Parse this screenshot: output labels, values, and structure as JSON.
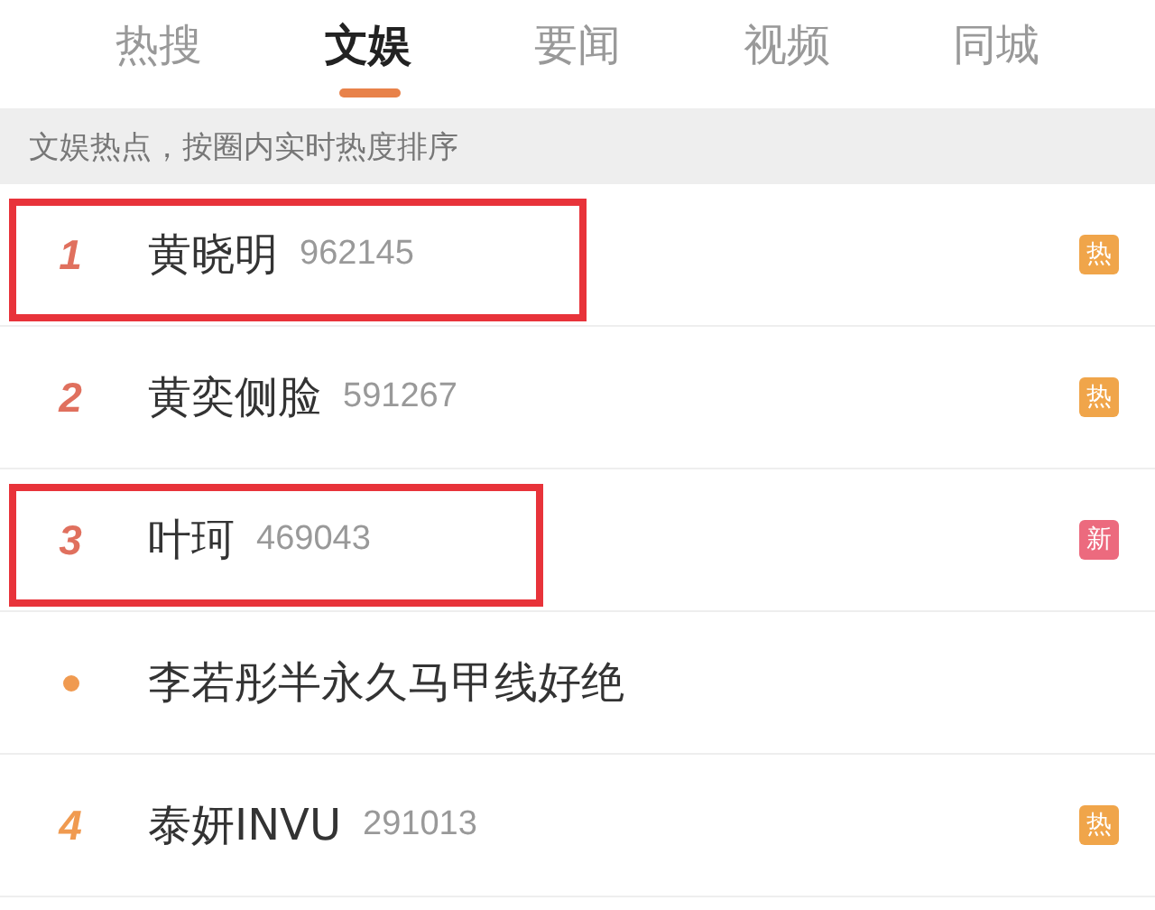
{
  "tabs": [
    {
      "label": "热搜",
      "selected": false
    },
    {
      "label": "文娱",
      "selected": true
    },
    {
      "label": "要闻",
      "selected": false
    },
    {
      "label": "视频",
      "selected": false
    },
    {
      "label": "同城",
      "selected": false
    }
  ],
  "subtitle": "文娱热点，按圈内实时热度排序",
  "items": [
    {
      "kind": "ranked",
      "rank": "1",
      "color": "#e0705e",
      "title": "黄晓明",
      "count": "962145",
      "badge": {
        "label": "热",
        "color": "#f0a54a"
      },
      "highlighted": true
    },
    {
      "kind": "ranked",
      "rank": "2",
      "color": "#e0705e",
      "title": "黄奕侧脸",
      "count": "591267",
      "badge": {
        "label": "热",
        "color": "#f0a54a"
      },
      "highlighted": false
    },
    {
      "kind": "ranked",
      "rank": "3",
      "color": "#e0705e",
      "title": "叶珂",
      "count": "469043",
      "badge": {
        "label": "新",
        "color": "#ec6a7e"
      },
      "highlighted": true
    },
    {
      "kind": "dot",
      "color": "#f09a50",
      "title": "李若彤半永久马甲线好绝",
      "highlighted": false
    },
    {
      "kind": "ranked",
      "rank": "4",
      "color": "#f09a50",
      "title": "泰妍INVU",
      "count": "291013",
      "badge": {
        "label": "热",
        "color": "#f0a54a"
      },
      "highlighted": false
    }
  ]
}
